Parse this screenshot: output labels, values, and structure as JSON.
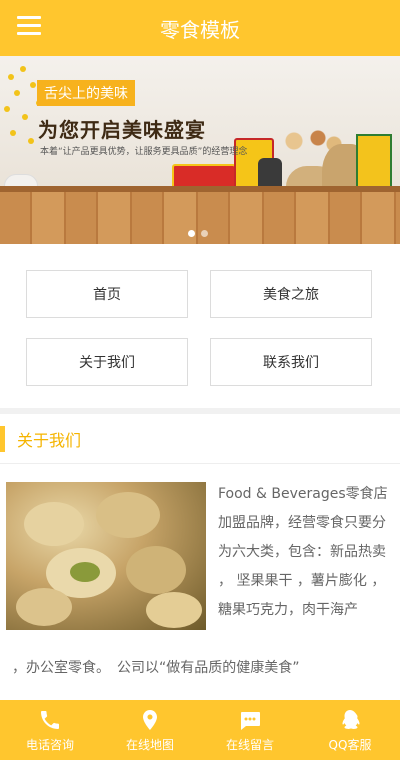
{
  "header": {
    "title": "零食模板",
    "menu_icon": "hamburger-menu-icon"
  },
  "banner": {
    "tag": "舌尖上的美味",
    "headline": "为您开启美味盛宴",
    "subline": "本着“让产品更具优势，让服务更具品质”的经营理念",
    "dots": 2,
    "active_dot": 0
  },
  "nav": {
    "items": [
      {
        "label": "首页"
      },
      {
        "label": "美食之旅"
      },
      {
        "label": "关于我们"
      },
      {
        "label": "联系我们"
      }
    ]
  },
  "about": {
    "title": "关于我们",
    "text_side": "Food & Beverages零食店加盟品牌，经营零食只要分为六大类，包含：新品热卖 ， 坚果果干 ，薯片膨化 ，糖果巧克力，肉干海产",
    "text_full": "，办公室零食。　公司以“做有品质的健康美食”"
  },
  "footer": {
    "items": [
      {
        "label": "电话咨询",
        "icon": "phone-icon"
      },
      {
        "label": "在线地图",
        "icon": "map-pin-icon"
      },
      {
        "label": "在线留言",
        "icon": "chat-icon"
      },
      {
        "label": "QQ客服",
        "icon": "qq-icon"
      }
    ]
  },
  "colors": {
    "accent": "#ffc62e",
    "title_accent": "#f5b400"
  }
}
